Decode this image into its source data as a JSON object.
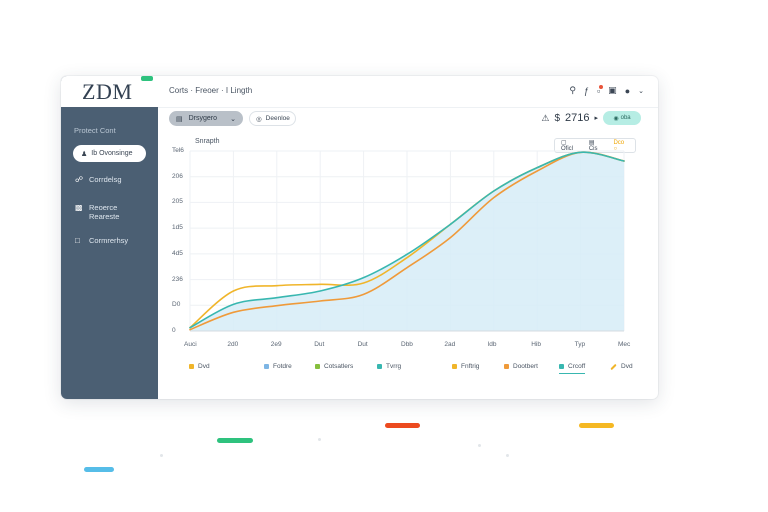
{
  "app": {
    "logo": "ZDM"
  },
  "sidebar": {
    "section_label": "Protect Cont",
    "active_item": {
      "icon": "user-icon",
      "label": "Ib Ovonsinge"
    },
    "items": [
      {
        "icon": "chart-icon",
        "label": "Corrdelsg"
      },
      {
        "icon": "bar-icon",
        "label": "Reoerce",
        "label2": "Reareste"
      },
      {
        "icon": "square-icon",
        "label": "Cormrerhsy"
      }
    ]
  },
  "header": {
    "breadcrumb": "Corts · Freoer · I Lingth",
    "icons": [
      "search-icon",
      "info-icon",
      "notification-icon",
      "lock-icon",
      "bell-icon",
      "chevron-down-icon"
    ]
  },
  "toolbar": {
    "dropdown_label": "Drsygero",
    "details_label": "Deenloe",
    "metric_value": "2716",
    "toggle_label": "oba"
  },
  "colors": {
    "sidebar": "#4b5f73",
    "area_fill": "#d6ecf7",
    "line_teal": "#38b7b0",
    "line_gold": "#f0b52a",
    "line_orange": "#ef9a3a",
    "line_green": "#86bf3d"
  },
  "segment_buttons": [
    "Oficl",
    "Cis",
    "Dco"
  ],
  "chart_data": {
    "type": "area",
    "title": "Snrapth",
    "y_ticks": [
      "Tel6",
      "206",
      "205",
      "1d5",
      "4d5",
      "236",
      "D0",
      "0"
    ],
    "x_ticks": [
      "Auci",
      "2d0",
      "2e9",
      "Dut",
      "Dut",
      "Dbb",
      "2ad",
      "ldb",
      "Hib",
      "Typ",
      "Mec"
    ],
    "xlabel": "",
    "ylabel": "",
    "ylim": [
      0,
      270
    ],
    "x": [
      0,
      1,
      2,
      3,
      4,
      5,
      6,
      7,
      8,
      9,
      10
    ],
    "series": [
      {
        "name": "Tvrrg",
        "color": "#38b7b0",
        "values": [
          5,
          40,
          50,
          60,
          80,
          115,
          160,
          210,
          245,
          268,
          255
        ]
      },
      {
        "name": "Fnftrig",
        "color": "#f0b52a",
        "values": [
          5,
          60,
          68,
          70,
          72,
          110,
          160,
          210,
          245,
          268,
          255
        ]
      },
      {
        "name": "Dootbert",
        "color": "#ef9a3a",
        "values": [
          2,
          28,
          38,
          45,
          55,
          95,
          140,
          200,
          240,
          268,
          255
        ]
      }
    ],
    "legend": [
      {
        "label": "Dvd",
        "color": "#f0b52a"
      },
      {
        "label": "Fotdre",
        "color": "#7db5e4"
      },
      {
        "label": "Cotsatlers",
        "color": "#86bf3d"
      },
      {
        "label": "Tvrrg",
        "color": "#38b7b0"
      },
      {
        "label": "Fnftrig",
        "color": "#f0b52a"
      },
      {
        "label": "Dootbert",
        "color": "#ef9a3a"
      },
      {
        "label": "Crcoff",
        "color": "#38b7b0"
      },
      {
        "label": "Dvd",
        "color": "#f0b52a"
      }
    ],
    "legend_position": "bottom",
    "grid": true
  }
}
